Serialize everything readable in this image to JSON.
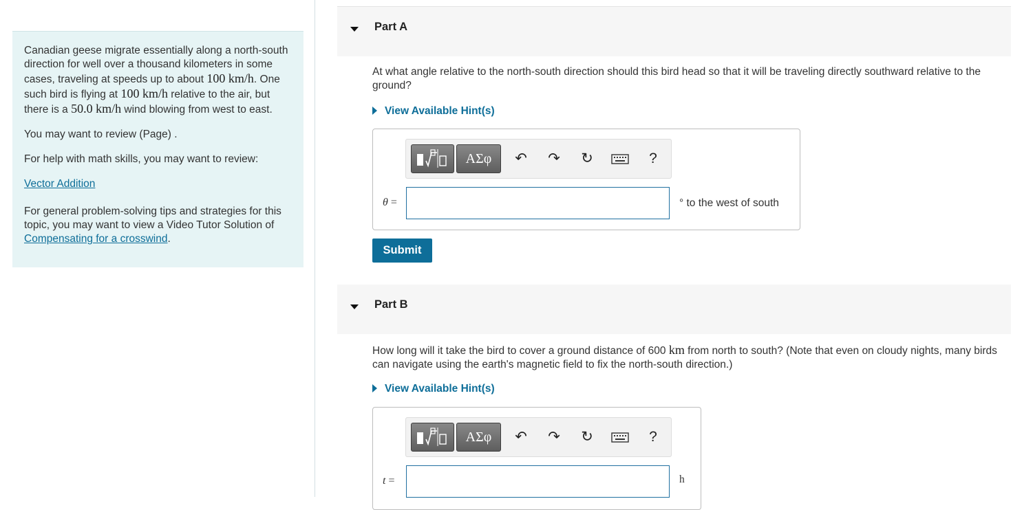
{
  "intro": {
    "text_1": "Canadian geese migrate essentially along a north-south direction for well over a thousand kilometers in some cases, traveling at speeds up to about ",
    "speed_1": "100",
    "unit_kmh": "km/h",
    "text_2": ". One such bird is flying at ",
    "speed_2": "100",
    "text_3": " relative to the air, but there is a ",
    "wind_speed": "50.0",
    "text_4": " wind blowing from west to east."
  },
  "review_page": "You may want to review (Page) .",
  "math_help_text": "For help with math skills, you may want to review:",
  "vector_link": "Vector Addition",
  "tutor_text": "For general problem-solving tips and strategies for this topic, you may want to view a Video Tutor Solution of ",
  "tutor_link": "Compensating for a crosswind",
  "tutor_end": ".",
  "toolbar": {
    "symbols_label": "ΑΣφ",
    "undo_icon": "↶",
    "redo_icon": "↷",
    "reset_icon": "↻",
    "help_label": "?"
  },
  "part_a": {
    "title": "Part A",
    "question": "At what angle relative to the north-south direction should this bird head so that it will be traveling directly southward relative to the ground?",
    "hint_label": "View Available Hint(s)",
    "variable": "θ",
    "equals": "=",
    "unit": "° to the west of south",
    "submit_label": "Submit"
  },
  "part_b": {
    "title": "Part B",
    "question_1": "How long will it take the bird to cover a ground distance of 600 ",
    "question_unit": "km",
    "question_2": " from north to south? (Note that even on cloudy nights, many birds can navigate using the earth's magnetic field to fix the north-south direction.)",
    "hint_label": "View Available Hint(s)",
    "variable": "t",
    "equals": "=",
    "unit": "h"
  }
}
